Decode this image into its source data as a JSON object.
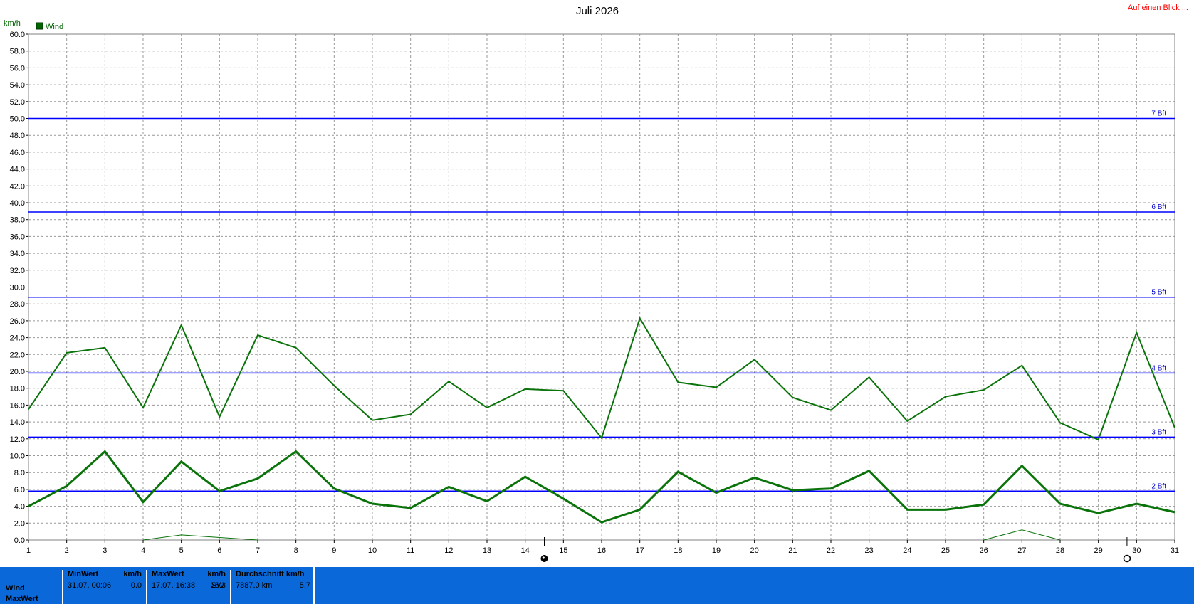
{
  "title": "Juli 2026",
  "link_label": "Auf einen Blick ...",
  "y_unit": "km/h",
  "legend": {
    "label": "Wind",
    "color": "#006400"
  },
  "colors": {
    "series": "#0a730a",
    "grid": "#999999",
    "threshold": "#0000ff",
    "footer": "#0a68d8"
  },
  "chart_data": {
    "type": "line",
    "title": "Juli 2026",
    "ylabel": "km/h",
    "ylim": [
      0,
      60
    ],
    "ytick_step": 2,
    "yticks": [
      "0.0",
      "2.0",
      "4.0",
      "6.0",
      "8.0",
      "10.0",
      "12.0",
      "14.0",
      "16.0",
      "18.0",
      "20.0",
      "22.0",
      "24.0",
      "26.0",
      "28.0",
      "30.0",
      "32.0",
      "34.0",
      "36.0",
      "38.0",
      "40.0",
      "42.0",
      "44.0",
      "46.0",
      "48.0",
      "50.0",
      "52.0",
      "54.0",
      "56.0",
      "58.0",
      "60.0"
    ],
    "xlim": [
      1,
      31
    ],
    "x": [
      1,
      2,
      3,
      4,
      5,
      6,
      7,
      8,
      9,
      10,
      11,
      12,
      13,
      14,
      15,
      16,
      17,
      18,
      19,
      20,
      21,
      22,
      23,
      24,
      25,
      26,
      27,
      28,
      29,
      30,
      31
    ],
    "xtick_labels": [
      "1",
      "2",
      "3",
      "4",
      "5",
      "6",
      "7",
      "8",
      "9",
      "10",
      "11",
      "12",
      "13",
      "14",
      "15",
      "16",
      "17",
      "18",
      "19",
      "20",
      "21",
      "22",
      "23",
      "24",
      "25",
      "26",
      "27",
      "28",
      "29",
      "30",
      "31"
    ],
    "grid": true,
    "legend_position": "top-left",
    "series": [
      {
        "name": "Wind",
        "role": "max",
        "width": 2,
        "values": [
          15.5,
          22.2,
          22.8,
          15.7,
          25.5,
          14.6,
          24.3,
          22.8,
          18.3,
          14.2,
          14.9,
          18.8,
          15.7,
          17.9,
          17.7,
          12.1,
          26.3,
          18.7,
          18.1,
          21.4,
          16.9,
          15.4,
          19.3,
          14.1,
          17.0,
          17.8,
          20.7,
          13.9,
          11.9,
          24.6,
          13.3
        ]
      },
      {
        "name": "Wind",
        "role": "average",
        "width": 3,
        "values": [
          4.0,
          6.4,
          10.5,
          4.5,
          9.3,
          5.8,
          7.3,
          10.5,
          6.1,
          4.3,
          3.8,
          6.3,
          4.6,
          7.5,
          4.9,
          2.1,
          3.6,
          8.1,
          5.6,
          7.4,
          5.9,
          6.1,
          8.2,
          3.6,
          3.6,
          4.2,
          8.8,
          4.3,
          3.2,
          4.3,
          3.3
        ]
      },
      {
        "name": "Wind",
        "role": "min",
        "width": 1,
        "values": [
          0,
          0,
          0,
          0,
          0.6,
          0.3,
          0,
          0,
          0,
          0,
          0,
          0,
          0,
          0,
          0,
          0,
          0,
          0,
          0,
          0,
          0,
          0,
          0,
          0,
          0,
          0,
          1.2,
          0,
          0,
          0,
          0
        ]
      }
    ],
    "thresholds": [
      {
        "label": "2 Bft",
        "value": 5.8
      },
      {
        "label": "3 Bft",
        "value": 12.2
      },
      {
        "label": "4 Bft",
        "value": 19.8
      },
      {
        "label": "5 Bft",
        "value": 28.8
      },
      {
        "label": "6 Bft",
        "value": 38.9
      },
      {
        "label": "7 Bft",
        "value": 50.0
      }
    ],
    "moon_phases": [
      {
        "x": 14.5,
        "phase": "full-moon"
      },
      {
        "x": 29.75,
        "phase": "new-moon"
      }
    ]
  },
  "stats": {
    "row_labels": [
      "Wind",
      "MaxWert"
    ],
    "min": {
      "header": "MinWert",
      "unit": "km/h",
      "when": "31.07.  00:06",
      "value": "0.0"
    },
    "max": {
      "header": "MaxWert",
      "unit": "km/h",
      "when": "17.07.  16:38",
      "dir": "SW",
      "value": "26.3"
    },
    "avg": {
      "header": "Durchschnitt km/h",
      "distance": "7887.0 km",
      "value": "5.7"
    }
  }
}
